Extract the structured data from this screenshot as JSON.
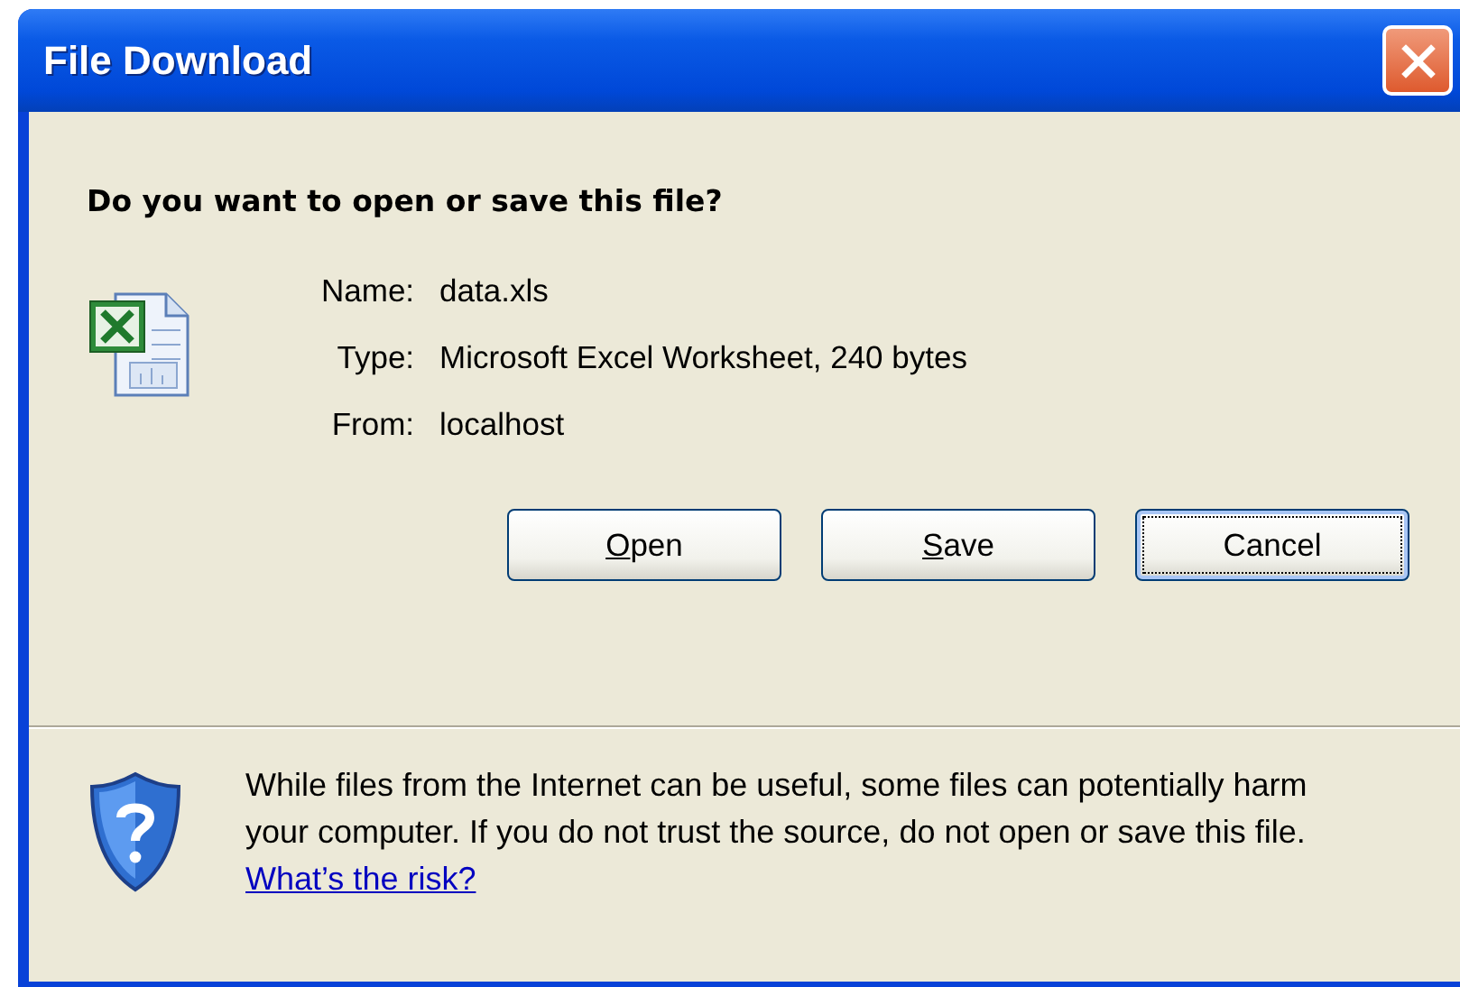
{
  "window": {
    "title": "File Download"
  },
  "question": "Do you want to open or save this file?",
  "file_info": [
    {
      "label": "Name:",
      "value": "data.xls"
    },
    {
      "label": "Type:",
      "value": "Microsoft Excel Worksheet, 240 bytes"
    },
    {
      "label": "From:",
      "value": "localhost"
    }
  ],
  "buttons": [
    {
      "label": "Open",
      "underline_first": true,
      "default": false
    },
    {
      "label": "Save",
      "underline_first": true,
      "default": false
    },
    {
      "label": "Cancel",
      "underline_first": false,
      "default": true
    }
  ],
  "warning": {
    "text": "While files from the Internet can be useful, some files can potentially harm your computer. If you do not trust the source, do not open or save this file.",
    "link": "What’s the risk?"
  }
}
